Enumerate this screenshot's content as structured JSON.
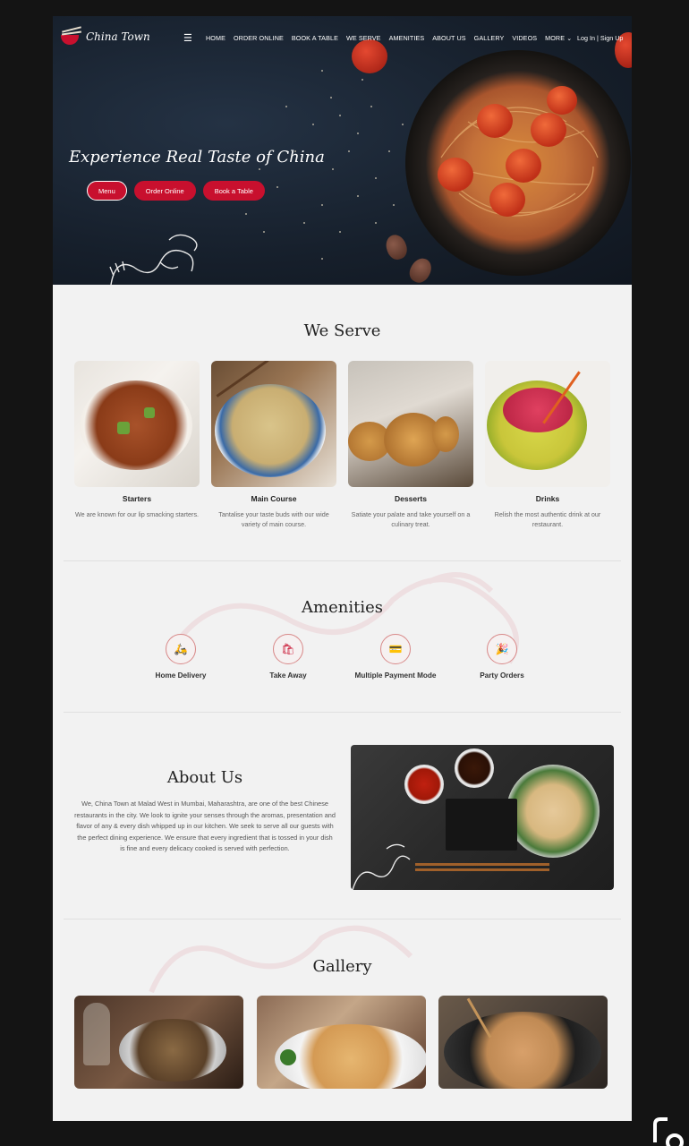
{
  "brand": {
    "name": "China Town"
  },
  "nav": {
    "menu_icon": "hamburger-icon",
    "links": [
      "HOME",
      "ORDER ONLINE",
      "BOOK A TABLE",
      "WE SERVE",
      "AMENITIES",
      "ABOUT US",
      "GALLERY",
      "VIDEOS",
      "MORE"
    ],
    "more_icon": "chevron-down-icon",
    "auth": "Log In | Sign Up"
  },
  "hero": {
    "title": "Experience Real Taste of China",
    "buttons": [
      "Menu",
      "Order Online",
      "Book a Table"
    ]
  },
  "we_serve": {
    "title": "We Serve",
    "cards": [
      {
        "title": "Starters",
        "text": "We are known for our lip smacking starters."
      },
      {
        "title": "Main Course",
        "text": "Tantalise your taste buds with our wide variety of main course."
      },
      {
        "title": "Desserts",
        "text": "Satiate your palate and take yourself on a culinary treat."
      },
      {
        "title": "Drinks",
        "text": "Relish the most authentic drink at our restaurant."
      }
    ]
  },
  "amenities": {
    "title": "Amenities",
    "items": [
      {
        "label": "Home Delivery",
        "icon": "scooter-icon"
      },
      {
        "label": "Take Away",
        "icon": "takeaway-bag-icon"
      },
      {
        "label": "Multiple Payment Mode",
        "icon": "wallet-icon"
      },
      {
        "label": "Party Orders",
        "icon": "party-popper-icon"
      }
    ]
  },
  "about": {
    "title": "About Us",
    "text": "We, China Town at Malad West in Mumbai, Maharashtra, are one of the best Chinese restaurants in the city. We look to ignite your senses through the aromas, presentation and flavor of any & every dish whipped up in our kitchen. We seek to serve all our guests with the perfect dining experience. We ensure that every ingredient that is tossed in your dish is fine and every delicacy cooked is served with perfection."
  },
  "gallery": {
    "title": "Gallery"
  },
  "colors": {
    "brand_red": "#c8102e",
    "hero_bg": "#161f2b",
    "page_bg": "#f2f2f2"
  }
}
